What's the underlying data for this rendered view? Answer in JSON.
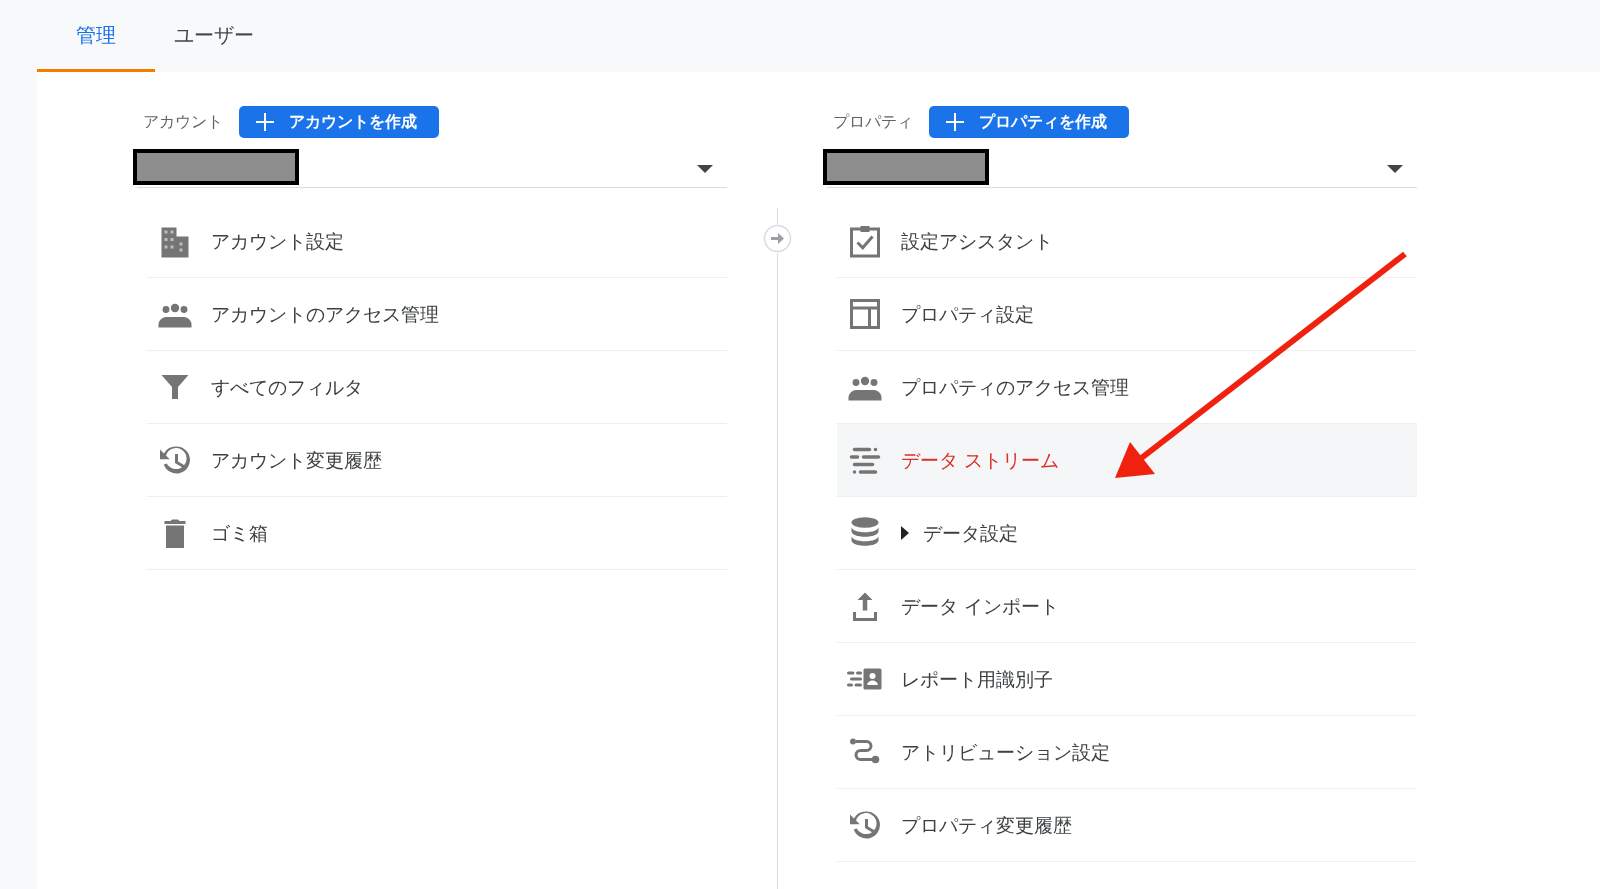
{
  "tabs": [
    {
      "label": "管理",
      "selected": true
    },
    {
      "label": "ユーザー",
      "selected": false
    }
  ],
  "account": {
    "label": "アカウント",
    "create_button": "アカウントを作成",
    "items": [
      {
        "kind": "building",
        "label": "アカウント設定",
        "selected": false
      },
      {
        "kind": "people",
        "label": "アカウントのアクセス管理",
        "selected": false
      },
      {
        "kind": "filter",
        "label": "すべてのフィルタ",
        "selected": false
      },
      {
        "kind": "history",
        "label": "アカウント変更履歴",
        "selected": false
      },
      {
        "kind": "trash",
        "label": "ゴミ箱",
        "selected": false
      }
    ]
  },
  "property": {
    "label": "プロパティ",
    "create_button": "プロパティを作成",
    "items": [
      {
        "kind": "clipboard",
        "label": "設定アシスタント",
        "selected": false
      },
      {
        "kind": "layout",
        "label": "プロパティ設定",
        "selected": false
      },
      {
        "kind": "people",
        "label": "プロパティのアクセス管理",
        "selected": false
      },
      {
        "kind": "stream",
        "label": "データ ストリーム",
        "selected": true
      },
      {
        "kind": "database",
        "label": "データ設定",
        "selected": false,
        "expandable": true
      },
      {
        "kind": "upload",
        "label": "データ インポート",
        "selected": false
      },
      {
        "kind": "idlist",
        "label": "レポート用識別子",
        "selected": false
      },
      {
        "kind": "route",
        "label": "アトリビューション設定",
        "selected": false
      },
      {
        "kind": "history",
        "label": "プロパティ変更履歴",
        "selected": false
      }
    ]
  }
}
